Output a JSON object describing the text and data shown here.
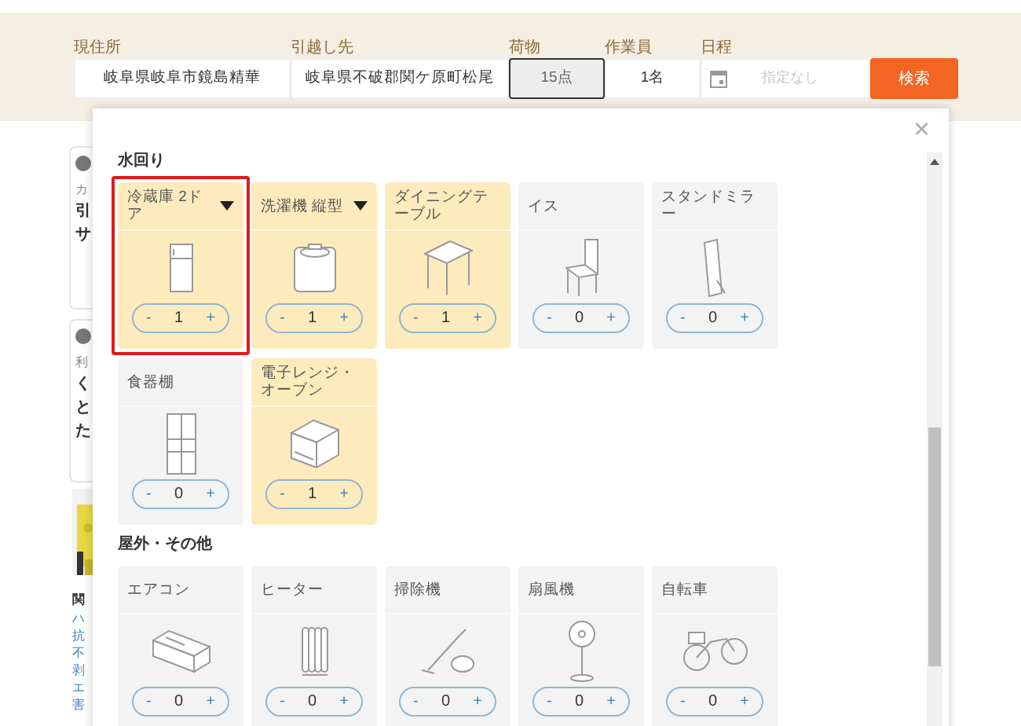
{
  "search_bar": {
    "fields": [
      {
        "label": "現住所",
        "value": "岐阜県岐阜市鏡島精華",
        "kind": "text",
        "selected": false
      },
      {
        "label": "引越し先",
        "value": "岐阜県不破郡関ケ原町松尾",
        "kind": "text",
        "selected": false
      },
      {
        "label": "荷物",
        "value": "15点",
        "kind": "text",
        "selected": true
      },
      {
        "label": "作業員",
        "value": "1名",
        "kind": "text",
        "selected": false
      },
      {
        "label": "日程",
        "placeholder": "指定なし",
        "kind": "date",
        "selected": false
      }
    ],
    "button": "検索"
  },
  "background_page": {
    "cards": [
      {
        "caption": "カ",
        "title": [
          "引",
          "サ"
        ]
      },
      {
        "caption": "利",
        "title": [
          "く",
          "と",
          "た"
        ]
      }
    ],
    "related": {
      "title": "関",
      "links": [
        "ハ",
        "抗",
        "不",
        "剥",
        "エ",
        "害"
      ]
    }
  },
  "popup": {
    "close": "×",
    "sections": [
      {
        "title": "水回り",
        "items": [
          {
            "label": "冷蔵庫 2ドア",
            "kind": "fridge",
            "dropdown": true,
            "minus": "-",
            "count": "1",
            "plus": "+",
            "selected": true,
            "highlighted": true
          },
          {
            "label": "洗濯機 縦型",
            "kind": "washer",
            "dropdown": true,
            "minus": "-",
            "count": "1",
            "plus": "+",
            "selected": true,
            "highlighted": false
          },
          {
            "label": "ダイニングテーブル",
            "kind": "table",
            "dropdown": false,
            "minus": "-",
            "count": "1",
            "plus": "+",
            "selected": true,
            "highlighted": false
          },
          {
            "label": "イス",
            "kind": "chair",
            "dropdown": false,
            "minus": "-",
            "count": "0",
            "plus": "+",
            "selected": false,
            "highlighted": false
          },
          {
            "label": "スタンドミラー",
            "kind": "mirror",
            "dropdown": false,
            "minus": "-",
            "count": "0",
            "plus": "+",
            "selected": false,
            "highlighted": false
          },
          {
            "label": "食器棚",
            "kind": "cabinet",
            "dropdown": false,
            "minus": "-",
            "count": "0",
            "plus": "+",
            "selected": false,
            "highlighted": false
          },
          {
            "label": "電子レンジ・オーブン",
            "kind": "microwave",
            "dropdown": false,
            "minus": "-",
            "count": "1",
            "plus": "+",
            "selected": true,
            "highlighted": false
          }
        ]
      },
      {
        "title": "屋外・その他",
        "items": [
          {
            "label": "エアコン",
            "kind": "aircon",
            "dropdown": false,
            "minus": "-",
            "count": "0",
            "plus": "+",
            "selected": false,
            "highlighted": false
          },
          {
            "label": "ヒーター",
            "kind": "heater",
            "dropdown": false,
            "minus": "-",
            "count": "0",
            "plus": "+",
            "selected": false,
            "highlighted": false
          },
          {
            "label": "掃除機",
            "kind": "vacuum",
            "dropdown": false,
            "minus": "-",
            "count": "0",
            "plus": "+",
            "selected": false,
            "highlighted": false
          },
          {
            "label": "扇風機",
            "kind": "fan",
            "dropdown": false,
            "minus": "-",
            "count": "0",
            "plus": "+",
            "selected": false,
            "highlighted": false
          },
          {
            "label": "自転車",
            "kind": "bicycle",
            "dropdown": false,
            "minus": "-",
            "count": "0",
            "plus": "+",
            "selected": false,
            "highlighted": false
          }
        ]
      }
    ]
  }
}
